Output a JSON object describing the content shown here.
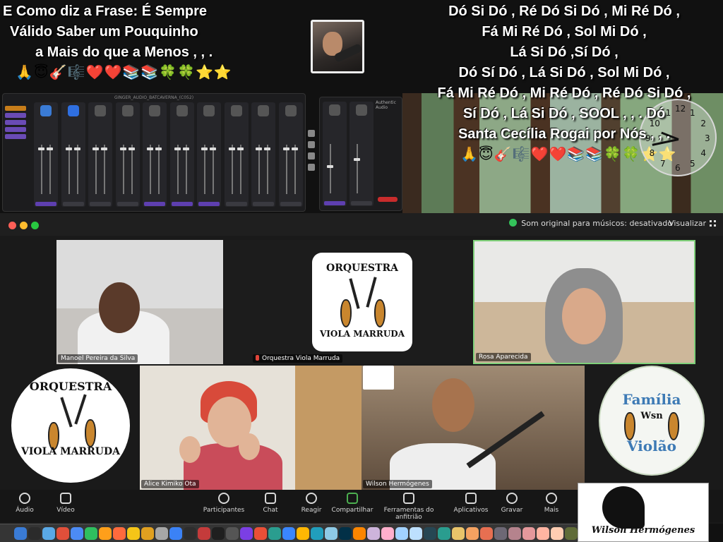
{
  "banner": {
    "left_lines": [
      "E Como diz a Frase: É Sempre",
      "Válido Saber um Pouquinho",
      "a Mais do que a Menos ,  , ."
    ],
    "left_emojis": "🙏😇🎸🎼❤️❤️📚📚🍀🍀⭐⭐",
    "right_emojis": "🙏😇🎸🎼❤️❤️📚📚🍀🍀⭐⭐",
    "lyrics": [
      "Dó Si Dó , Ré Dó Si Dó , Mi Ré Dó ,",
      "Fá Mi Ré Dó , Sol Mi Dó ,",
      "Lá Si Dó ,Sí Dó ,",
      "Dó Sí Dó , Lá Si Dó , Sol Mi Dó ,",
      "Fá Mi Ré Dó , Mi Ré Dó , Ré Dó Si Dó ,",
      "Sí Dó , Lá Si Dó , SOOL ,  ,  . Dó",
      "Santa Cecília Rogai por Nós ,  ,  ."
    ]
  },
  "clock": {
    "numbers": [
      "12",
      "1",
      "2",
      "3",
      "4",
      "5",
      "6",
      "7",
      "8",
      "9",
      "10",
      "11"
    ],
    "hour": 9,
    "minute": 43
  },
  "mixer": {
    "title": "GINGER_AUDIO_BATCAVERNA_(C052)",
    "side_items": [
      "Applause",
      "Media",
      "Phone",
      "Phone",
      "Screen"
    ],
    "strip_labels": [
      "SoundBoard",
      "Desktop Audio",
      "Behind",
      "MIC 1",
      "Sound IN",
      "MIC 2",
      "Sound IN",
      "Buffer Pro",
      "Synth",
      "Pro Tools",
      "MacPro"
    ],
    "right_panel": {
      "title": "Authentic Audio",
      "recorder": "Audio Recorder",
      "record": "RECORD",
      "strip_labels": [
        "MIC 02",
        "Stream Mix"
      ]
    }
  },
  "zoom": {
    "original_sound": "Som original para músicos: desativado",
    "view_label": "Visualizar",
    "tiles": [
      {
        "name": "Manoel Pereira da Silva",
        "muted": false
      },
      {
        "name": "Orquestra Viola Marruda",
        "muted": true
      },
      {
        "name": "Rosa Aparecida",
        "muted": false
      },
      {
        "name": "Alice Kimiko Ota",
        "muted": false
      },
      {
        "name": "Wilson Hermógenes",
        "muted": false
      }
    ],
    "logos": {
      "orquestra_top": "ORQUESTRA",
      "orquestra_bottom": "VIOLA MARRUDA",
      "familia_top": "Família",
      "familia_mid": "Wsn",
      "familia_bottom": "Violão",
      "wilson_signature": "Wilson Hermógenes"
    },
    "toolbar": {
      "audio": "Áudio",
      "video": "Vídeo",
      "participants": "Participantes",
      "participants_count": "6",
      "chat": "Chat",
      "react": "Reagir",
      "share": "Compartilhar",
      "whiteboard": "Ferramentas do anfitrião",
      "apps": "Aplicativos",
      "record": "Gravar",
      "more": "Mais"
    }
  },
  "colors": {
    "active_speaker_border": "#7fd07a",
    "accent_purple": "#6a4bb5",
    "record_red": "#c82c2c"
  }
}
